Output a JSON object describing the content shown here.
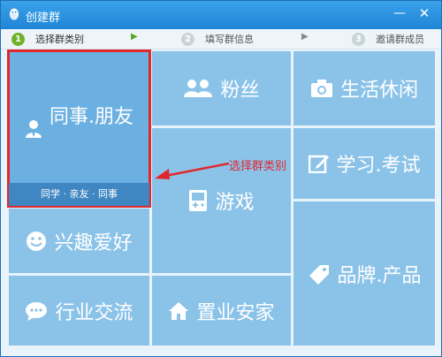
{
  "window": {
    "title": "创建群"
  },
  "steps": [
    {
      "num": "1",
      "label": "选择群类别"
    },
    {
      "num": "2",
      "label": "填写群信息"
    },
    {
      "num": "3",
      "label": "邀请群成员"
    }
  ],
  "categories": {
    "friends": {
      "label": "同事.朋友",
      "sub": "同学 · 亲友 · 同事"
    },
    "fans": {
      "label": "粉丝"
    },
    "life": {
      "label": "生活休闲"
    },
    "games": {
      "label": "游戏"
    },
    "study": {
      "label": "学习.考试"
    },
    "hobby": {
      "label": "兴趣爱好"
    },
    "brand": {
      "label": "品牌.产品"
    },
    "industry": {
      "label": "行业交流"
    },
    "home": {
      "label": "置业安家"
    }
  },
  "annotation": {
    "text": "选择群类别"
  },
  "colors": {
    "tile": "#8bc3e8",
    "selected": "#6bb0e0",
    "highlight": "#e0272e",
    "title_bar": "#2b93e0"
  }
}
